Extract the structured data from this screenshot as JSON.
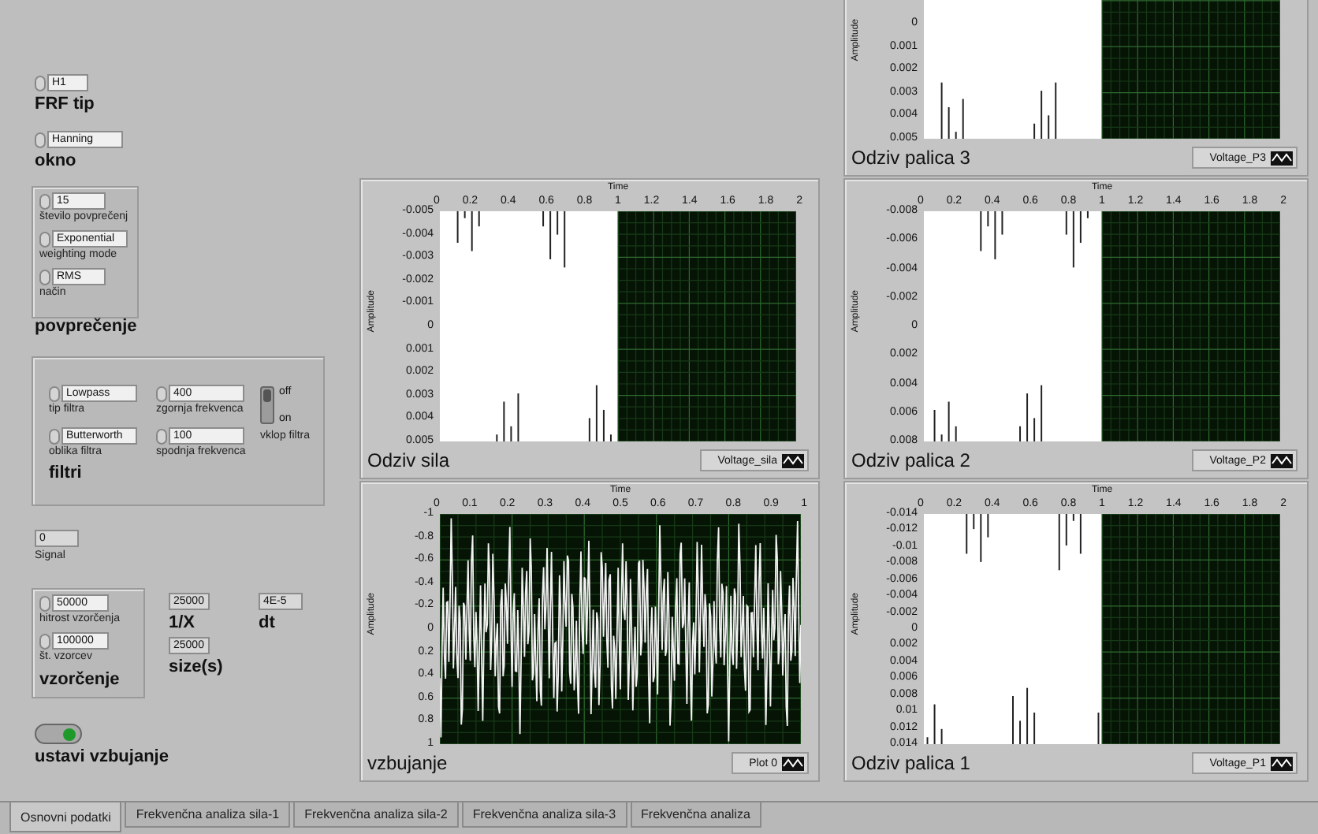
{
  "frf_type": {
    "label": "FRF tip",
    "value": "H1"
  },
  "window_type": {
    "label": "okno",
    "value": "Hanning"
  },
  "averaging": {
    "title": "povprečenje",
    "fields": [
      {
        "label": "število povprečenj",
        "value": "15"
      },
      {
        "label": "weighting mode",
        "value": "Exponential"
      },
      {
        "label": "način",
        "value": "RMS"
      }
    ]
  },
  "filters": {
    "title": "filtri",
    "fields": [
      {
        "label": "tip filtra",
        "value": "Lowpass"
      },
      {
        "label": "zgornja frekvenca",
        "value": "400"
      },
      {
        "label": "oblika filtra",
        "value": "Butterworth"
      },
      {
        "label": "spodnja frekvenca",
        "value": "100"
      }
    ],
    "switch": {
      "label": "vklop filtra",
      "off_label": "off",
      "on_label": "on",
      "on": false
    }
  },
  "signal": {
    "label": "Signal",
    "value": "0"
  },
  "sampling": {
    "title": "vzorčenje",
    "fields": [
      {
        "label": "hitrost vzorčenja",
        "value": "50000"
      },
      {
        "label": "št. vzorcev",
        "value": "100000"
      }
    ]
  },
  "indicators": [
    {
      "label": "1/X",
      "value": "25000"
    },
    {
      "label": "dt",
      "value": "4E-5"
    },
    {
      "label": "size(s)",
      "value": "25000"
    }
  ],
  "stop_button": {
    "label": "ustavi vzbujanje",
    "on": true
  },
  "graphs": [
    {
      "kind": "response",
      "title": "Odziv palica 3",
      "legend": "Voltage_P3",
      "y_label": "Amplitude",
      "y_ticks": [
        "0",
        "0.001",
        "0.002",
        "0.003",
        "0.004",
        "0.005"
      ]
    },
    {
      "kind": "response",
      "title": "Odziv sila",
      "legend": "Voltage_sila",
      "y_label": "Amplitude",
      "x_label": "Time",
      "y_ticks": [
        "-0.005",
        "-0.004",
        "-0.003",
        "-0.002",
        "-0.001",
        "0",
        "0.001",
        "0.002",
        "0.003",
        "0.004",
        "0.005"
      ],
      "x_ticks": [
        "0",
        "0.2",
        "0.4",
        "0.6",
        "0.8",
        "1",
        "1.2",
        "1.4",
        "1.6",
        "1.8",
        "2"
      ]
    },
    {
      "kind": "response",
      "title": "Odziv palica 2",
      "legend": "Voltage_P2",
      "y_label": "Amplitude",
      "x_label": "Time",
      "y_ticks": [
        "-0.008",
        "-0.006",
        "-0.004",
        "-0.002",
        "0",
        "0.002",
        "0.004",
        "0.006",
        "0.008"
      ],
      "x_ticks": [
        "0",
        "0.2",
        "0.4",
        "0.6",
        "0.8",
        "1",
        "1.2",
        "1.4",
        "1.6",
        "1.8",
        "2"
      ]
    },
    {
      "kind": "excitation",
      "title": "vzbujanje",
      "legend": "Plot 0",
      "y_label": "Amplitude",
      "x_label": "Time",
      "y_ticks": [
        "-1",
        "-0.8",
        "-0.6",
        "-0.4",
        "-0.2",
        "0",
        "0.2",
        "0.4",
        "0.6",
        "0.8",
        "1"
      ],
      "x_ticks": [
        "0",
        "0.1",
        "0.2",
        "0.3",
        "0.4",
        "0.5",
        "0.6",
        "0.7",
        "0.8",
        "0.9",
        "1"
      ]
    },
    {
      "kind": "response",
      "title": "Odziv palica 1",
      "legend": "Voltage_P1",
      "y_label": "Amplitude",
      "x_label": "Time",
      "y_ticks": [
        "-0.014",
        "-0.012",
        "-0.01",
        "-0.008",
        "-0.006",
        "-0.004",
        "-0.002",
        "0",
        "0.002",
        "0.004",
        "0.006",
        "0.008",
        "0.01",
        "0.012",
        "0.014"
      ],
      "x_ticks": [
        "0",
        "0.2",
        "0.4",
        "0.6",
        "0.8",
        "1",
        "1.2",
        "1.4",
        "1.6",
        "1.8",
        "2"
      ]
    }
  ],
  "tabs": [
    {
      "label": "Osnovni podatki",
      "selected": true
    },
    {
      "label": "Frekvenčna analiza sila-1",
      "selected": false
    },
    {
      "label": "Frekvenčna analiza sila-2",
      "selected": false
    },
    {
      "label": "Frekvenčna analiza sila-3",
      "selected": false
    },
    {
      "label": "Frekvenčna analiza",
      "selected": false
    }
  ]
}
